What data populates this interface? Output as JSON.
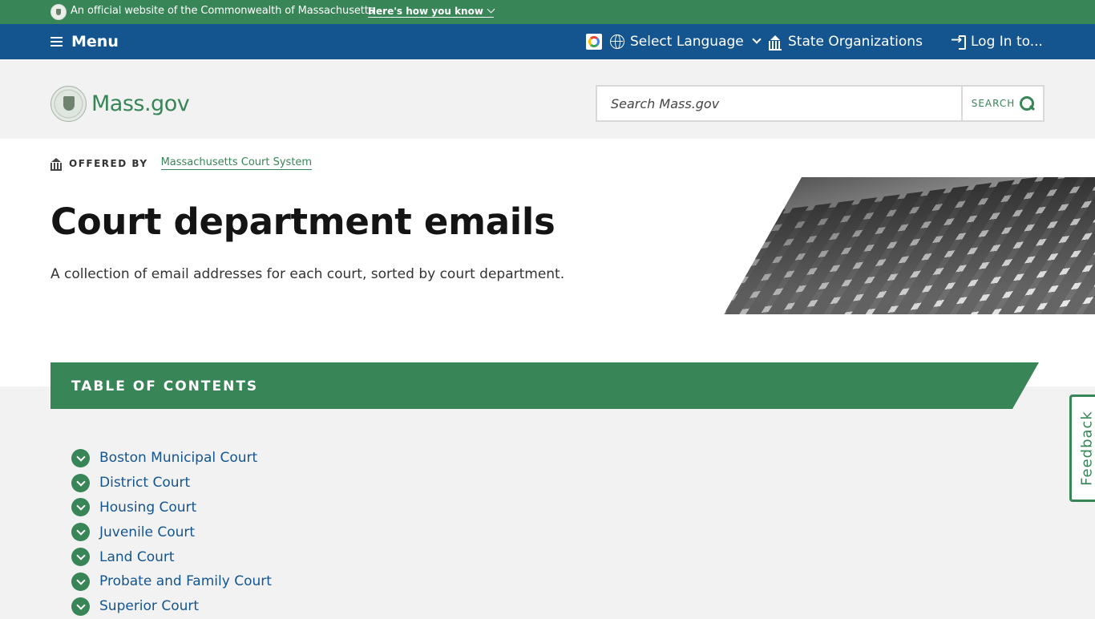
{
  "official_banner": {
    "text": "An official website of the Commonwealth of Massachusetts",
    "link": "Here's how you know"
  },
  "utility_nav": {
    "menu_label": "Menu",
    "language_label": "Select Language",
    "state_orgs_label": "State Organizations",
    "login_label": "Log In to..."
  },
  "header": {
    "logo_text": "Mass.gov",
    "search_placeholder": "Search Mass.gov",
    "search_button": "SEARCH"
  },
  "page": {
    "offered_by_label": "OFFERED BY",
    "offered_by_org": "Massachusetts Court System",
    "title": "Court department emails",
    "lede": "A collection of email addresses for each court, sorted by court department."
  },
  "toc": {
    "heading": "TABLE OF CONTENTS",
    "items": [
      "Boston Municipal Court",
      "District Court",
      "Housing Court",
      "Juvenile Court",
      "Land Court",
      "Probate and Family Court",
      "Superior Court"
    ]
  },
  "feedback": {
    "label": "Feedback"
  },
  "colors": {
    "green": "#388557",
    "blue": "#14558f",
    "background": "#f2f2f2"
  }
}
